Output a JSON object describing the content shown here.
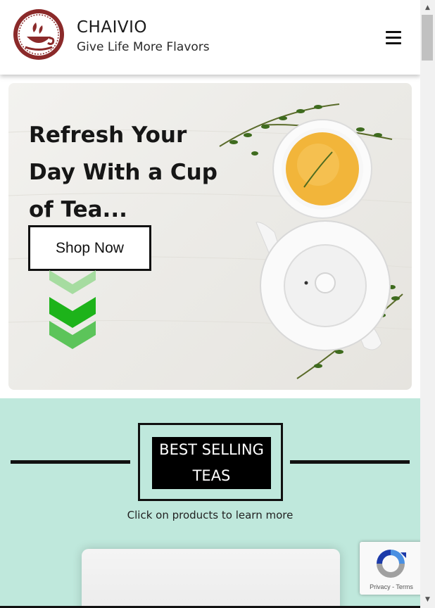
{
  "header": {
    "brand_title": "CHAIVIO",
    "tagline": "Give Life More Flavors",
    "menu_icon": "hamburger-menu-icon",
    "logo_icon": "tea-cup-logo-icon"
  },
  "hero": {
    "headline_lines": [
      "Refresh Your",
      "Day With a Cup",
      "of Tea..."
    ],
    "cta_label": "Shop Now",
    "scroll_icon": "double-chevron-down-icon"
  },
  "best_sellers": {
    "badge_lines": [
      "BEST SELLING",
      "TEAS"
    ],
    "subtitle": "Click on products to learn more"
  },
  "recaptcha": {
    "privacy_label": "Privacy",
    "separator": " - ",
    "terms_label": "Terms"
  },
  "scrollbar": {
    "up_glyph": "▲",
    "down_glyph": "▼"
  },
  "colors": {
    "brand": "#8b2a2a",
    "section_bg": "#bfe8dc",
    "chevron_green": "#22b322"
  }
}
